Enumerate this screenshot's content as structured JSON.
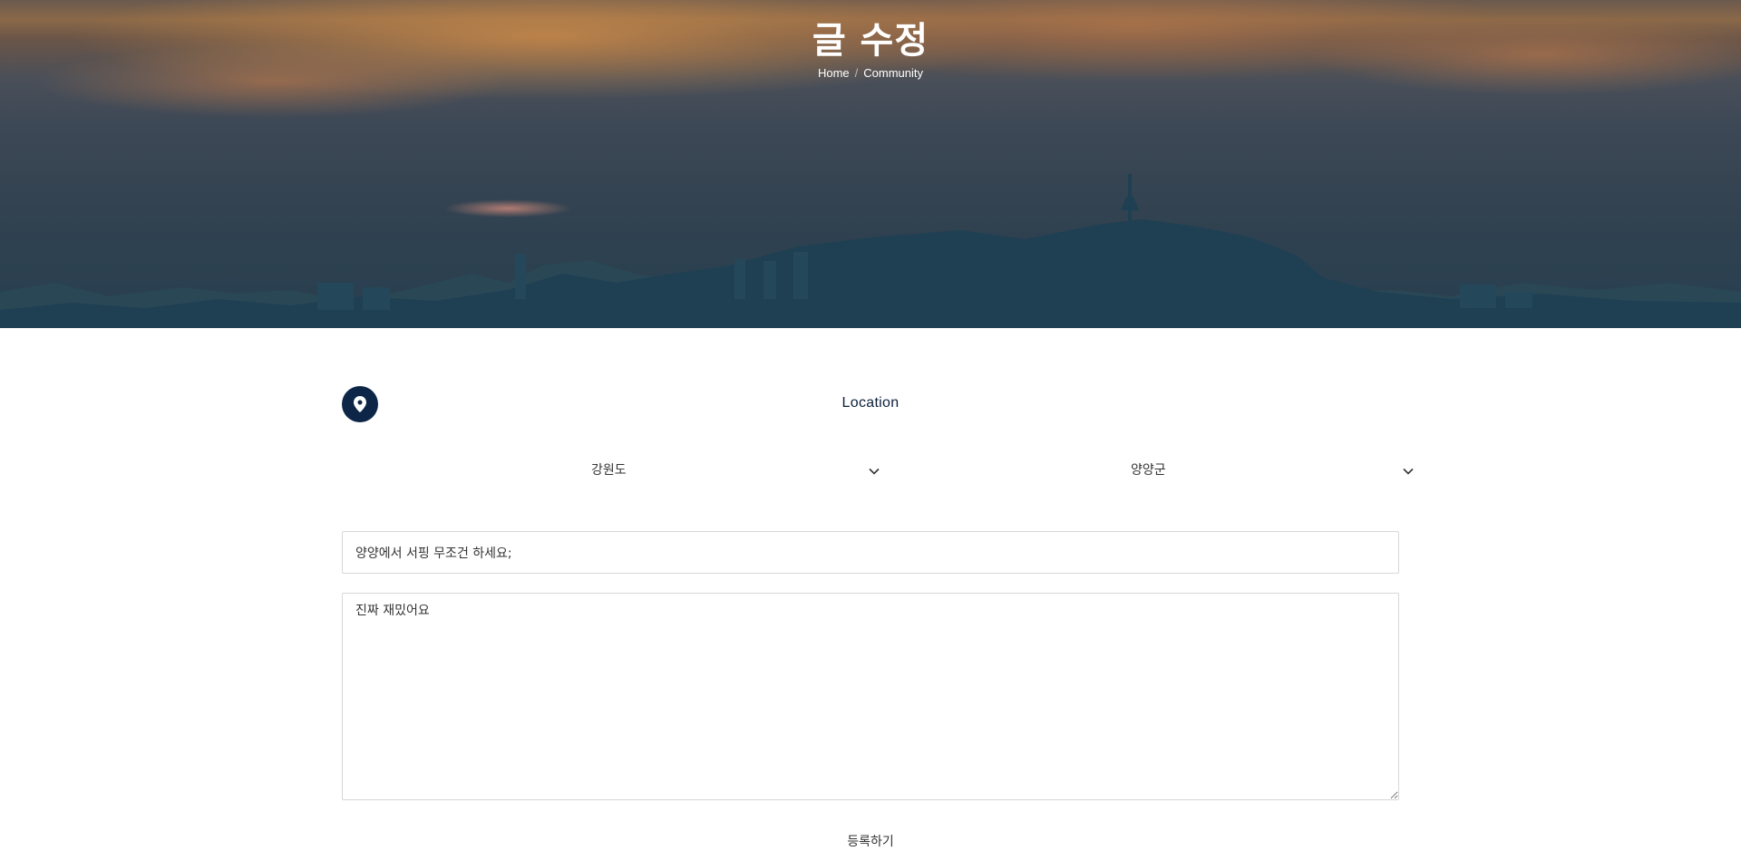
{
  "header": {
    "title": "글 수정",
    "breadcrumb": [
      {
        "label": "Home"
      },
      {
        "label": "Community"
      }
    ]
  },
  "location": {
    "label": "Location",
    "icon": "map-pin-icon",
    "province": {
      "selected": "강원도",
      "icon": "chevron-down-icon"
    },
    "district": {
      "selected": "양양군",
      "icon": "chevron-down-icon"
    }
  },
  "form": {
    "title_value": "양양에서 서핑 무조건 하세요;",
    "body_value": "진짜 재밌어요",
    "submit_label": "등록하기"
  },
  "colors": {
    "accent": "#0d2647",
    "border": "#d7d7d7"
  }
}
